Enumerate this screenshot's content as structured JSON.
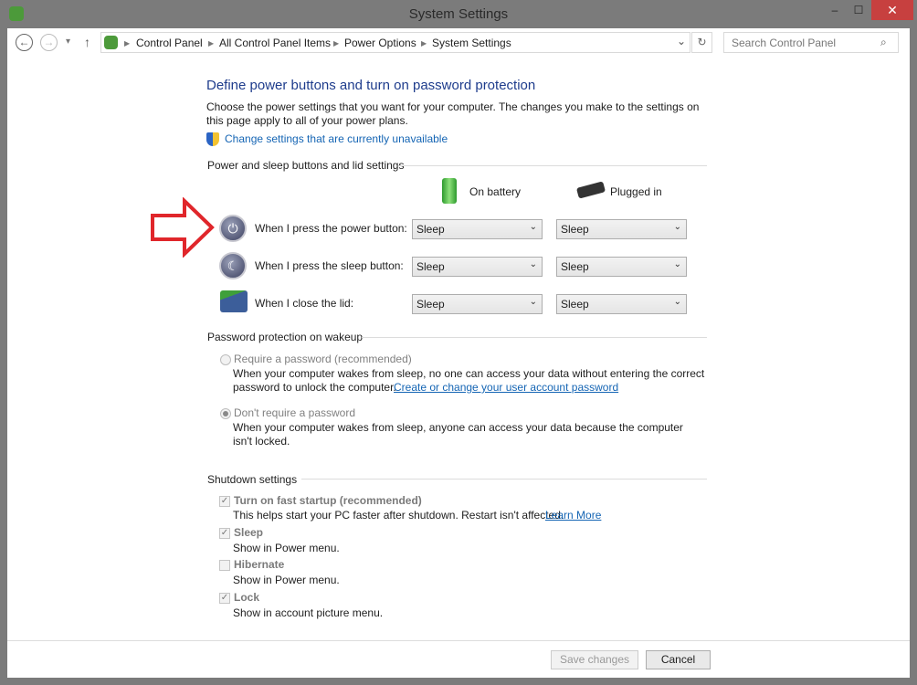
{
  "window": {
    "title": "System Settings",
    "minimize": "–",
    "maximize": "☐",
    "close": "✕"
  },
  "nav": {
    "back": "←",
    "forward": "→",
    "recent": "▾",
    "up": "↑",
    "refresh": "↻",
    "dropdown": "⌄"
  },
  "breadcrumb": [
    "Control Panel",
    "All Control Panel Items",
    "Power Options",
    "System Settings"
  ],
  "search": {
    "placeholder": "Search Control Panel"
  },
  "page": {
    "title": "Define power buttons and turn on password protection",
    "intro": "Choose the power settings that you want for your computer. The changes you make to the settings on this page apply to all of your power plans.",
    "change_link": "Change settings that are currently unavailable"
  },
  "power": {
    "group": "Power and sleep buttons and lid settings",
    "col_battery": "On battery",
    "col_plugged": "Plugged in",
    "rows": [
      {
        "label": "When I press the power button:",
        "battery": "Sleep",
        "plugged": "Sleep"
      },
      {
        "label": "When I press the sleep button:",
        "battery": "Sleep",
        "plugged": "Sleep"
      },
      {
        "label": "When I close the lid:",
        "battery": "Sleep",
        "plugged": "Sleep"
      }
    ]
  },
  "password": {
    "group": "Password protection on wakeup",
    "require_label": "Require a password (recommended)",
    "require_desc": "When your computer wakes from sleep, no one can access your data without entering the correct",
    "require_desc2": "password to unlock the computer.",
    "require_link": "Create or change your user account password",
    "norequire_label": "Don't require a password",
    "norequire_desc": "When your computer wakes from sleep, anyone can access your data because the computer isn't locked.",
    "selected": "Don't require a password"
  },
  "shutdown": {
    "group": "Shutdown settings",
    "items": [
      {
        "label": "Turn on fast startup (recommended)",
        "desc": "This helps start your PC faster after shutdown. Restart isn't affected.",
        "link": "Learn More",
        "checked": true
      },
      {
        "label": "Sleep",
        "desc": "Show in Power menu.",
        "checked": true
      },
      {
        "label": "Hibernate",
        "desc": "Show in Power menu.",
        "checked": false
      },
      {
        "label": "Lock",
        "desc": "Show in account picture menu.",
        "checked": true
      }
    ]
  },
  "footer": {
    "save": "Save changes",
    "cancel": "Cancel"
  },
  "colors": {
    "heading": "#1e3c8c",
    "link": "#1565b4",
    "close": "#c7403f",
    "arrow": "#e0262b"
  }
}
